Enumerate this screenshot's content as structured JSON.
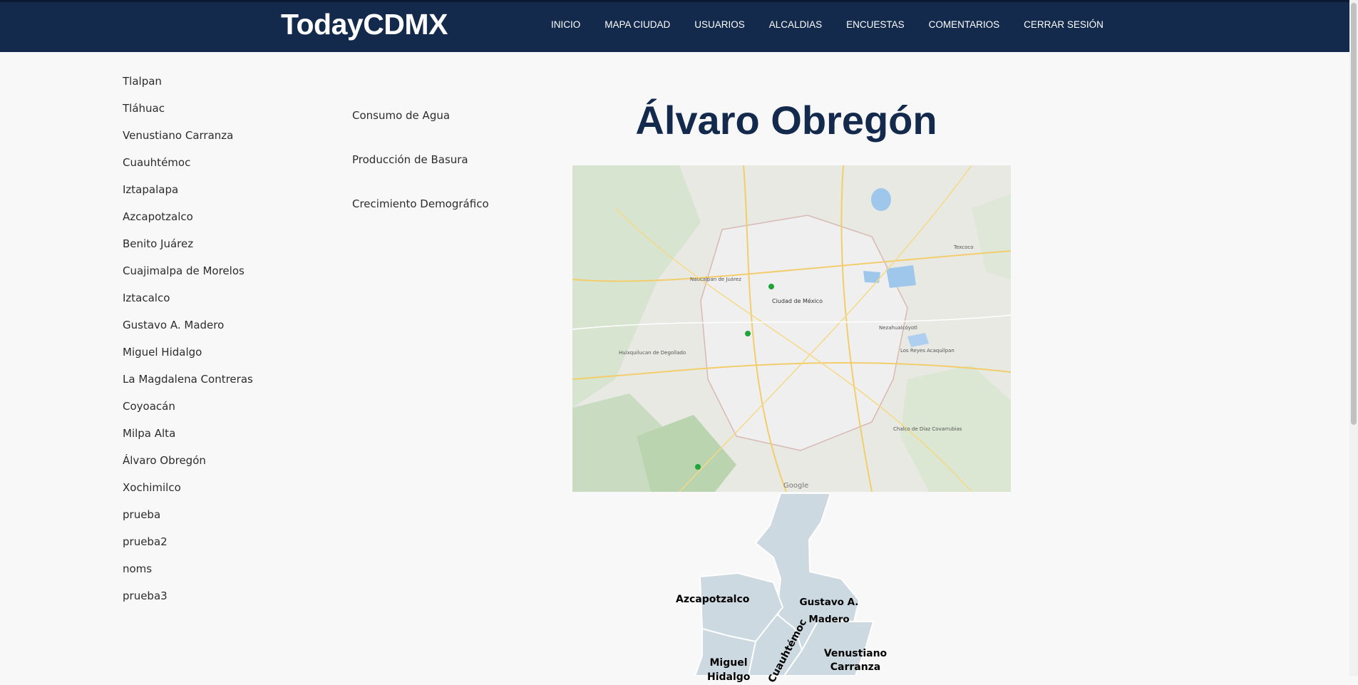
{
  "nav": {
    "brand": "TodayCDMX",
    "links": [
      "INICIO",
      "MAPA CIUDAD",
      "USUARIOS",
      "ALCALDIAS",
      "ENCUESTAS",
      "COMENTARIOS",
      "CERRAR SESIÓN"
    ]
  },
  "sidebar": {
    "items": [
      "Tlalpan",
      "Tláhuac",
      "Venustiano Carranza",
      "Cuauhtémoc",
      "Iztapalapa",
      "Azcapotzalco",
      "Benito Juárez",
      "Cuajimalpa de Morelos",
      "Iztacalco",
      "Gustavo A. Madero",
      "Miguel Hidalgo",
      "La Magdalena Contreras",
      "Coyoacán",
      "Milpa Alta",
      "Álvaro Obregón",
      "Xochimilco",
      "prueba",
      "prueba2",
      "noms",
      "prueba3"
    ]
  },
  "submenu": {
    "items": [
      "Consumo de Agua",
      "Producción de Basura",
      "Crecimiento Demográfico"
    ]
  },
  "main": {
    "title": "Álvaro Obregón"
  },
  "map": {
    "labels": {
      "ciudad": "Ciudad de México",
      "naucalpan": "Naucalpan de Juárez",
      "texcoco": "Texcoco",
      "huixquilucan": "Huixquilucan de Degollado",
      "nezahualcoyotl": "Nezahualcóyotl",
      "reyes": "Los Reyes Acaquilpan",
      "chalco": "Chalco de Díaz Covarrubias",
      "google": "Google"
    }
  },
  "alcaldias_map": {
    "azcapotzalco": "Azcapotzalco",
    "gustavo": "Gustavo A. Madero",
    "miguel": "Miguel Hidalgo",
    "cuauhtemoc": "Cuauhtémoc",
    "venustiano": "Venustiano Carranza"
  },
  "colors": {
    "navbar": "#132a4d",
    "title": "#132a4d",
    "region_fill": "#ccd9e0"
  }
}
